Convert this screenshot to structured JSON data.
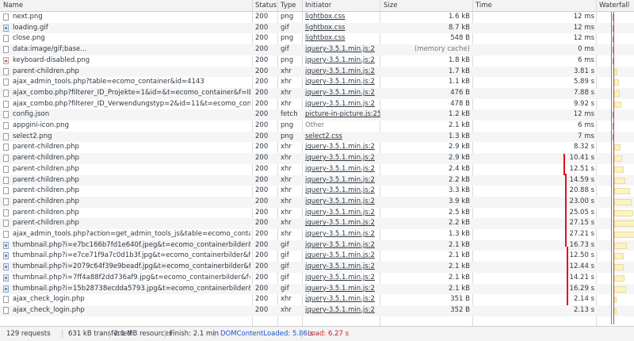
{
  "headers": {
    "name": "Name",
    "status": "Status",
    "type": "Type",
    "initiator": "Initiator",
    "size": "Size",
    "time": "Time",
    "waterfall": "Waterfall"
  },
  "rows": [
    {
      "name": "next.png",
      "status": "200",
      "type": "png",
      "initiator": "lightbox.css",
      "size": "1.6 kB",
      "time": "12 ms",
      "icon": "file-icon"
    },
    {
      "name": "loading.gif",
      "status": "200",
      "type": "gif",
      "initiator": "lightbox.css",
      "size": "8.7 kB",
      "time": "12 ms",
      "icon": "image-file-icon"
    },
    {
      "name": "close.png",
      "status": "200",
      "type": "png",
      "initiator": "lightbox.css",
      "size": "548 B",
      "time": "12 ms",
      "icon": "file-icon"
    },
    {
      "name": "data:image/gif;base...",
      "status": "200",
      "type": "gif",
      "initiator": "jquery-3.5.1.min.js:2",
      "size": "(memory cache)",
      "time": "0 ms",
      "icon": "file-icon",
      "cache": true
    },
    {
      "name": "keyboard-disabled.png",
      "status": "200",
      "type": "png",
      "initiator": "jquery-3.5.1.min.js:2",
      "size": "1.8 kB",
      "time": "6 ms",
      "icon": "broken-image-icon"
    },
    {
      "name": "parent-children.php",
      "status": "200",
      "type": "xhr",
      "initiator": "jquery-3.5.1.min.js:2",
      "size": "1.7 kB",
      "time": "3.81 s",
      "icon": "file-icon"
    },
    {
      "name": "ajax_admin_tools.php?table=ecomo_container&id=4143",
      "status": "200",
      "type": "xhr",
      "initiator": "jquery-3.5.1.min.js:2",
      "size": "1.1 kB",
      "time": "5.89 s",
      "icon": "file-icon"
    },
    {
      "name": "ajax_combo.php?filterer_ID_Projekte=1&id=&t=ecomo_container&f=ID_ProjekteZ...",
      "status": "200",
      "type": "xhr",
      "initiator": "jquery-3.5.1.min.js:2",
      "size": "476 B",
      "time": "7.88 s",
      "icon": "file-icon"
    },
    {
      "name": "ajax_combo.php?filterer_ID_Verwendungstyp=2&id=11&t=ecomo_container&f=ID_Verwe...",
      "status": "200",
      "type": "xhr",
      "initiator": "jquery-3.5.1.min.js:2",
      "size": "478 B",
      "time": "9.92 s",
      "icon": "file-icon"
    },
    {
      "name": "config.json",
      "status": "200",
      "type": "fetch",
      "initiator": "picture-in-picture.js:250",
      "size": "1.2 kB",
      "time": "12 ms",
      "icon": "file-icon"
    },
    {
      "name": "appgini-icon.png",
      "status": "200",
      "type": "png",
      "initiator": "Other",
      "size": "2.1 kB",
      "time": "6 ms",
      "icon": "file-icon",
      "plain": true
    },
    {
      "name": "select2.png",
      "status": "200",
      "type": "png",
      "initiator": "select2.css",
      "size": "1.3 kB",
      "time": "7 ms",
      "icon": "file-icon"
    },
    {
      "name": "parent-children.php",
      "status": "200",
      "type": "xhr",
      "initiator": "jquery-3.5.1.min.js:2",
      "size": "2.9 kB",
      "time": "8.32 s",
      "icon": "file-icon"
    },
    {
      "name": "parent-children.php",
      "status": "200",
      "type": "xhr",
      "initiator": "jquery-3.5.1.min.js:2",
      "size": "2.9 kB",
      "time": "10.41 s",
      "icon": "file-icon"
    },
    {
      "name": "parent-children.php",
      "status": "200",
      "type": "xhr",
      "initiator": "jquery-3.5.1.min.js:2",
      "size": "2.4 kB",
      "time": "12.51 s",
      "icon": "file-icon"
    },
    {
      "name": "parent-children.php",
      "status": "200",
      "type": "xhr",
      "initiator": "jquery-3.5.1.min.js:2",
      "size": "2.2 kB",
      "time": "14.59 s",
      "icon": "file-icon"
    },
    {
      "name": "parent-children.php",
      "status": "200",
      "type": "xhr",
      "initiator": "jquery-3.5.1.min.js:2",
      "size": "3.3 kB",
      "time": "20.88 s",
      "icon": "file-icon"
    },
    {
      "name": "parent-children.php",
      "status": "200",
      "type": "xhr",
      "initiator": "jquery-3.5.1.min.js:2",
      "size": "3.9 kB",
      "time": "23.00 s",
      "icon": "file-icon"
    },
    {
      "name": "parent-children.php",
      "status": "200",
      "type": "xhr",
      "initiator": "jquery-3.5.1.min.js:2",
      "size": "2.5 kB",
      "time": "25.05 s",
      "icon": "file-icon"
    },
    {
      "name": "parent-children.php",
      "status": "200",
      "type": "xhr",
      "initiator": "jquery-3.5.1.min.js:2",
      "size": "2.2 kB",
      "time": "27.15 s",
      "icon": "file-icon"
    },
    {
      "name": "ajax_admin_tools.php?action=get_admin_tools_js&table=ecomo_container&id=4143",
      "status": "200",
      "type": "xhr",
      "initiator": "jquery-3.5.1.min.js:2",
      "size": "1.3 kB",
      "time": "27.21 s",
      "icon": "file-icon"
    },
    {
      "name": "thumbnail.php?i=e7bc166b7fd1e640f.jpeg&t=ecomo_containerbilder&f=Bild_Datei...",
      "status": "200",
      "type": "gif",
      "initiator": "jquery-3.5.1.min.js:2",
      "size": "2.1 kB",
      "time": "16.73 s",
      "icon": "image-file-icon"
    },
    {
      "name": "thumbnail.php?i=e7ce71f9a7c0d1b3f.jpg&t=ecomo_containerbilder&f=Bild_Datei...",
      "status": "200",
      "type": "gif",
      "initiator": "jquery-3.5.1.min.js:2",
      "size": "2.1 kB",
      "time": "12.50 s",
      "icon": "image-file-icon"
    },
    {
      "name": "thumbnail.php?i=2079c64f39e9beadf.jpg&t=ecomo_containerbilder&f=Bild_Datei&...",
      "status": "200",
      "type": "gif",
      "initiator": "jquery-3.5.1.min.js:2",
      "size": "2.1 kB",
      "time": "12.44 s",
      "icon": "image-file-icon"
    },
    {
      "name": "thumbnail.php?i=7ff4a88f2dd736af9.jpg&t=ecomo_containerbilder&f=Bild_Datei&...",
      "status": "200",
      "type": "gif",
      "initiator": "jquery-3.5.1.min.js:2",
      "size": "2.1 kB",
      "time": "14.21 s",
      "icon": "image-file-icon"
    },
    {
      "name": "thumbnail.php?i=15b28738ecdda5793.jpg&t=ecomo_containerbilder&f=Bild_Datei...",
      "status": "200",
      "type": "gif",
      "initiator": "jquery-3.5.1.min.js:2",
      "size": "2.1 kB",
      "time": "16.29 s",
      "icon": "image-file-icon"
    },
    {
      "name": "ajax_check_login.php",
      "status": "200",
      "type": "xhr",
      "initiator": "jquery-3.5.1.min.js:2",
      "size": "351 B",
      "time": "2.14 s",
      "icon": "file-icon"
    },
    {
      "name": "ajax_check_login.php",
      "status": "200",
      "type": "xhr",
      "initiator": "jquery-3.5.1.min.js:2",
      "size": "352 B",
      "time": "2.13 s",
      "icon": "file-icon"
    }
  ],
  "status_bar": {
    "requests": "129 requests",
    "transferred": "631 kB transferred",
    "resources": "2.1 MB resources",
    "finish": "Finish: 2.1 min",
    "dom": "DOMContentLoaded: 5.86 s",
    "load": "Load: 6.27 s"
  },
  "colors": {
    "dom": "#1a56c8",
    "load": "#c5221f",
    "annotation": "#e0101e",
    "waterfall_bar": "#fbf4c2"
  }
}
